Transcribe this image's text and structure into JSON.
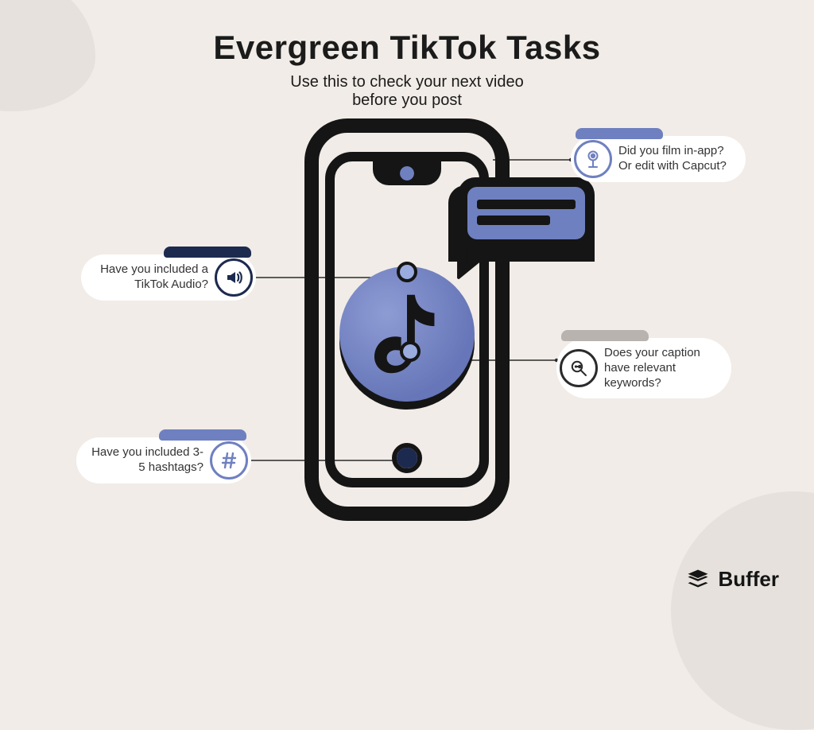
{
  "header": {
    "title": "Evergreen TikTok Tasks",
    "subtitle_line1": "Use this to check your next video",
    "subtitle_line2": "before you post"
  },
  "callouts": {
    "audio": {
      "text": "Have you included a TikTok Audio?",
      "icon": "sound-icon"
    },
    "hashtag": {
      "text": "Have you included 3-5 hashtags?",
      "icon": "hashtag-icon"
    },
    "film": {
      "text": "Did you film in-app? Or edit with Capcut?",
      "icon": "ringlight-icon"
    },
    "caption": {
      "text": "Does your caption have relevant keywords?",
      "icon": "search-key-icon"
    }
  },
  "brand": {
    "name": "Buffer"
  },
  "colors": {
    "background": "#f1ece7",
    "navy": "#1d2a4f",
    "periwinkle": "#6f80c0",
    "ink": "#1b1b1b"
  }
}
